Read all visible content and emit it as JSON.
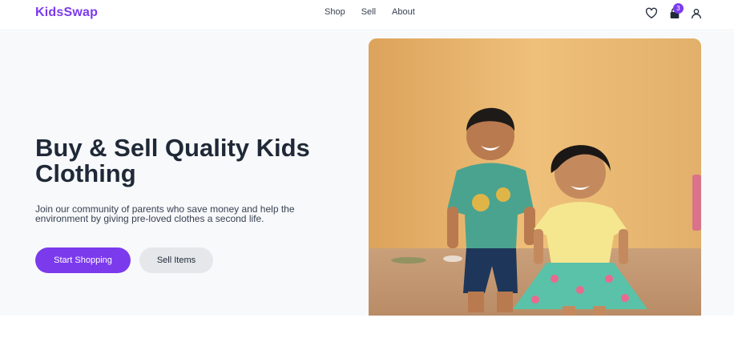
{
  "brand": {
    "name": "KidsSwap",
    "accent": "#7c3aed"
  },
  "nav": {
    "items": [
      {
        "label": "Shop"
      },
      {
        "label": "Sell"
      },
      {
        "label": "About"
      }
    ]
  },
  "header_icons": {
    "wishlist": "heart-icon",
    "cart": "shopping-bag-icon",
    "cart_count": "3",
    "account": "user-icon"
  },
  "hero": {
    "headline": "Buy & Sell Quality Kids Clothing",
    "subtitle": "Join our community of parents who save money and help the environment by giving pre-loved clothes a second life.",
    "primary_cta": "Start Shopping",
    "secondary_cta": "Sell Items"
  }
}
